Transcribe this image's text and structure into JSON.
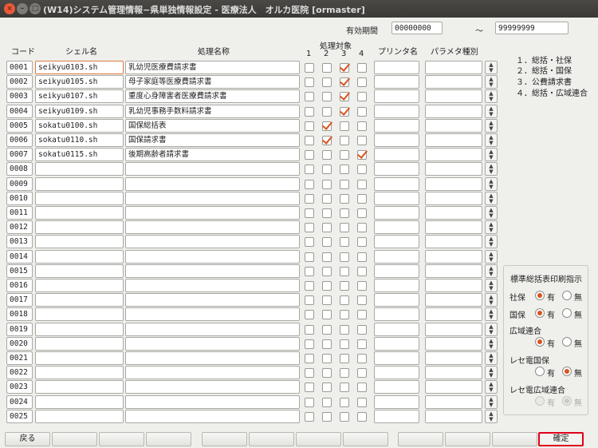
{
  "window": {
    "title": "(W14)システム管理情報−県単独情報設定 - 医療法人　オルカ医院  [ormaster]",
    "close": "×",
    "minimize": "–",
    "maximize": "□"
  },
  "period": {
    "label": "有効期間",
    "from": "00000000",
    "tilde": "〜",
    "to": "99999999"
  },
  "headers": {
    "code": "コード",
    "shell": "シェル名",
    "process_name": "処理名称",
    "target": "処理対象",
    "target_cols": [
      "1",
      "2",
      "3",
      "4"
    ],
    "printer": "プリンタ名",
    "param": "パラメタ種別"
  },
  "rows": [
    {
      "code": "0001",
      "shell": "seikyu0103.sh",
      "name": "乳幼児医療費請求書",
      "checks": [
        false,
        false,
        true,
        false
      ]
    },
    {
      "code": "0002",
      "shell": "seikyu0105.sh",
      "name": "母子家庭等医療費請求書",
      "checks": [
        false,
        false,
        true,
        false
      ]
    },
    {
      "code": "0003",
      "shell": "seikyu0107.sh",
      "name": "重度心身障害者医療費請求書",
      "checks": [
        false,
        false,
        true,
        false
      ]
    },
    {
      "code": "0004",
      "shell": "seikyu0109.sh",
      "name": "乳幼児事務手数料請求書",
      "checks": [
        false,
        false,
        true,
        false
      ]
    },
    {
      "code": "0005",
      "shell": "sokatu0100.sh",
      "name": "国保総括表",
      "checks": [
        false,
        true,
        false,
        false
      ]
    },
    {
      "code": "0006",
      "shell": "sokatu0110.sh",
      "name": "国保請求書",
      "checks": [
        false,
        true,
        false,
        false
      ]
    },
    {
      "code": "0007",
      "shell": "sokatu0115.sh",
      "name": "後期高齢者請求書",
      "checks": [
        false,
        false,
        false,
        true
      ]
    },
    {
      "code": "0008",
      "shell": "",
      "name": "",
      "checks": [
        false,
        false,
        false,
        false
      ]
    },
    {
      "code": "0009",
      "shell": "",
      "name": "",
      "checks": [
        false,
        false,
        false,
        false
      ]
    },
    {
      "code": "0010",
      "shell": "",
      "name": "",
      "checks": [
        false,
        false,
        false,
        false
      ]
    },
    {
      "code": "0011",
      "shell": "",
      "name": "",
      "checks": [
        false,
        false,
        false,
        false
      ]
    },
    {
      "code": "0012",
      "shell": "",
      "name": "",
      "checks": [
        false,
        false,
        false,
        false
      ]
    },
    {
      "code": "0013",
      "shell": "",
      "name": "",
      "checks": [
        false,
        false,
        false,
        false
      ]
    },
    {
      "code": "0014",
      "shell": "",
      "name": "",
      "checks": [
        false,
        false,
        false,
        false
      ]
    },
    {
      "code": "0015",
      "shell": "",
      "name": "",
      "checks": [
        false,
        false,
        false,
        false
      ]
    },
    {
      "code": "0016",
      "shell": "",
      "name": "",
      "checks": [
        false,
        false,
        false,
        false
      ]
    },
    {
      "code": "0017",
      "shell": "",
      "name": "",
      "checks": [
        false,
        false,
        false,
        false
      ]
    },
    {
      "code": "0018",
      "shell": "",
      "name": "",
      "checks": [
        false,
        false,
        false,
        false
      ]
    },
    {
      "code": "0019",
      "shell": "",
      "name": "",
      "checks": [
        false,
        false,
        false,
        false
      ]
    },
    {
      "code": "0020",
      "shell": "",
      "name": "",
      "checks": [
        false,
        false,
        false,
        false
      ]
    },
    {
      "code": "0021",
      "shell": "",
      "name": "",
      "checks": [
        false,
        false,
        false,
        false
      ]
    },
    {
      "code": "0022",
      "shell": "",
      "name": "",
      "checks": [
        false,
        false,
        false,
        false
      ]
    },
    {
      "code": "0023",
      "shell": "",
      "name": "",
      "checks": [
        false,
        false,
        false,
        false
      ]
    },
    {
      "code": "0024",
      "shell": "",
      "name": "",
      "checks": [
        false,
        false,
        false,
        false
      ]
    },
    {
      "code": "0025",
      "shell": "",
      "name": "",
      "checks": [
        false,
        false,
        false,
        false
      ]
    }
  ],
  "legend": [
    "１．総括・社保",
    "２．総括・国保",
    "３．公費請求書",
    "４．総括・広域連合"
  ],
  "print_group": {
    "title": "標準総括表印刷指示",
    "yes": "有",
    "no": "無",
    "items": [
      {
        "label": "社保",
        "value": "yes",
        "disabled": false
      },
      {
        "label": "国保",
        "value": "yes",
        "disabled": false
      },
      {
        "label": "広域連合",
        "value": "yes",
        "disabled": false
      },
      {
        "label": "レセ電国保",
        "value": "no",
        "disabled": false
      },
      {
        "label": "レセ電広域連合",
        "value": "no",
        "disabled": true
      }
    ]
  },
  "buttons": {
    "back": "戻る",
    "confirm": "確定"
  },
  "colors": {
    "accent": "#d9531e",
    "confirm_border": "#e0001a",
    "titlebar": "#3e3d3a"
  }
}
